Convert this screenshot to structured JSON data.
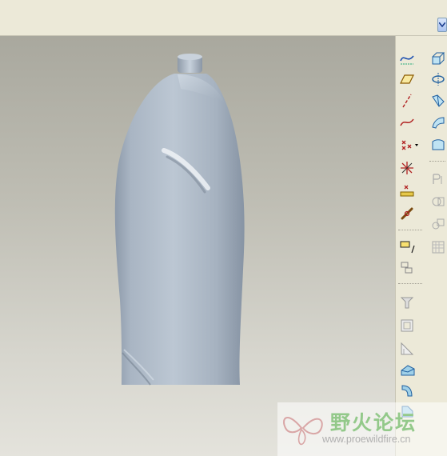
{
  "window": {
    "colors": {
      "chrome": "#ece9d8",
      "viewport_top": "#a9a89e",
      "viewport_bottom": "#e4e3dc",
      "model": "#a8b4c2"
    }
  },
  "viewport": {
    "model_name": "bottle-model",
    "color": "#a8b4c2"
  },
  "toolbar": {
    "column_left": [
      "sketch-curve-icon",
      "plane-icon",
      "axis-icon",
      "curve-icon",
      "point-icon",
      "coordinate-system-icon",
      "analysis-point-icon",
      "chain-icon",
      "annotation-icon",
      "layer-icon",
      "draft-icon",
      "shell-icon",
      "rib-icon",
      "blend-icon",
      "round-icon",
      "chamfer-icon"
    ],
    "column_right": [
      "extrude-icon",
      "revolve-icon",
      "sweep-icon",
      "blend-surface-icon",
      "boundary-icon",
      "merge-icon",
      "trim-icon",
      "pattern-icon",
      "mirror-icon"
    ]
  },
  "watermark": {
    "title": "野火论坛",
    "url": "www.proewildfire.cn",
    "color": "#93c98a"
  }
}
